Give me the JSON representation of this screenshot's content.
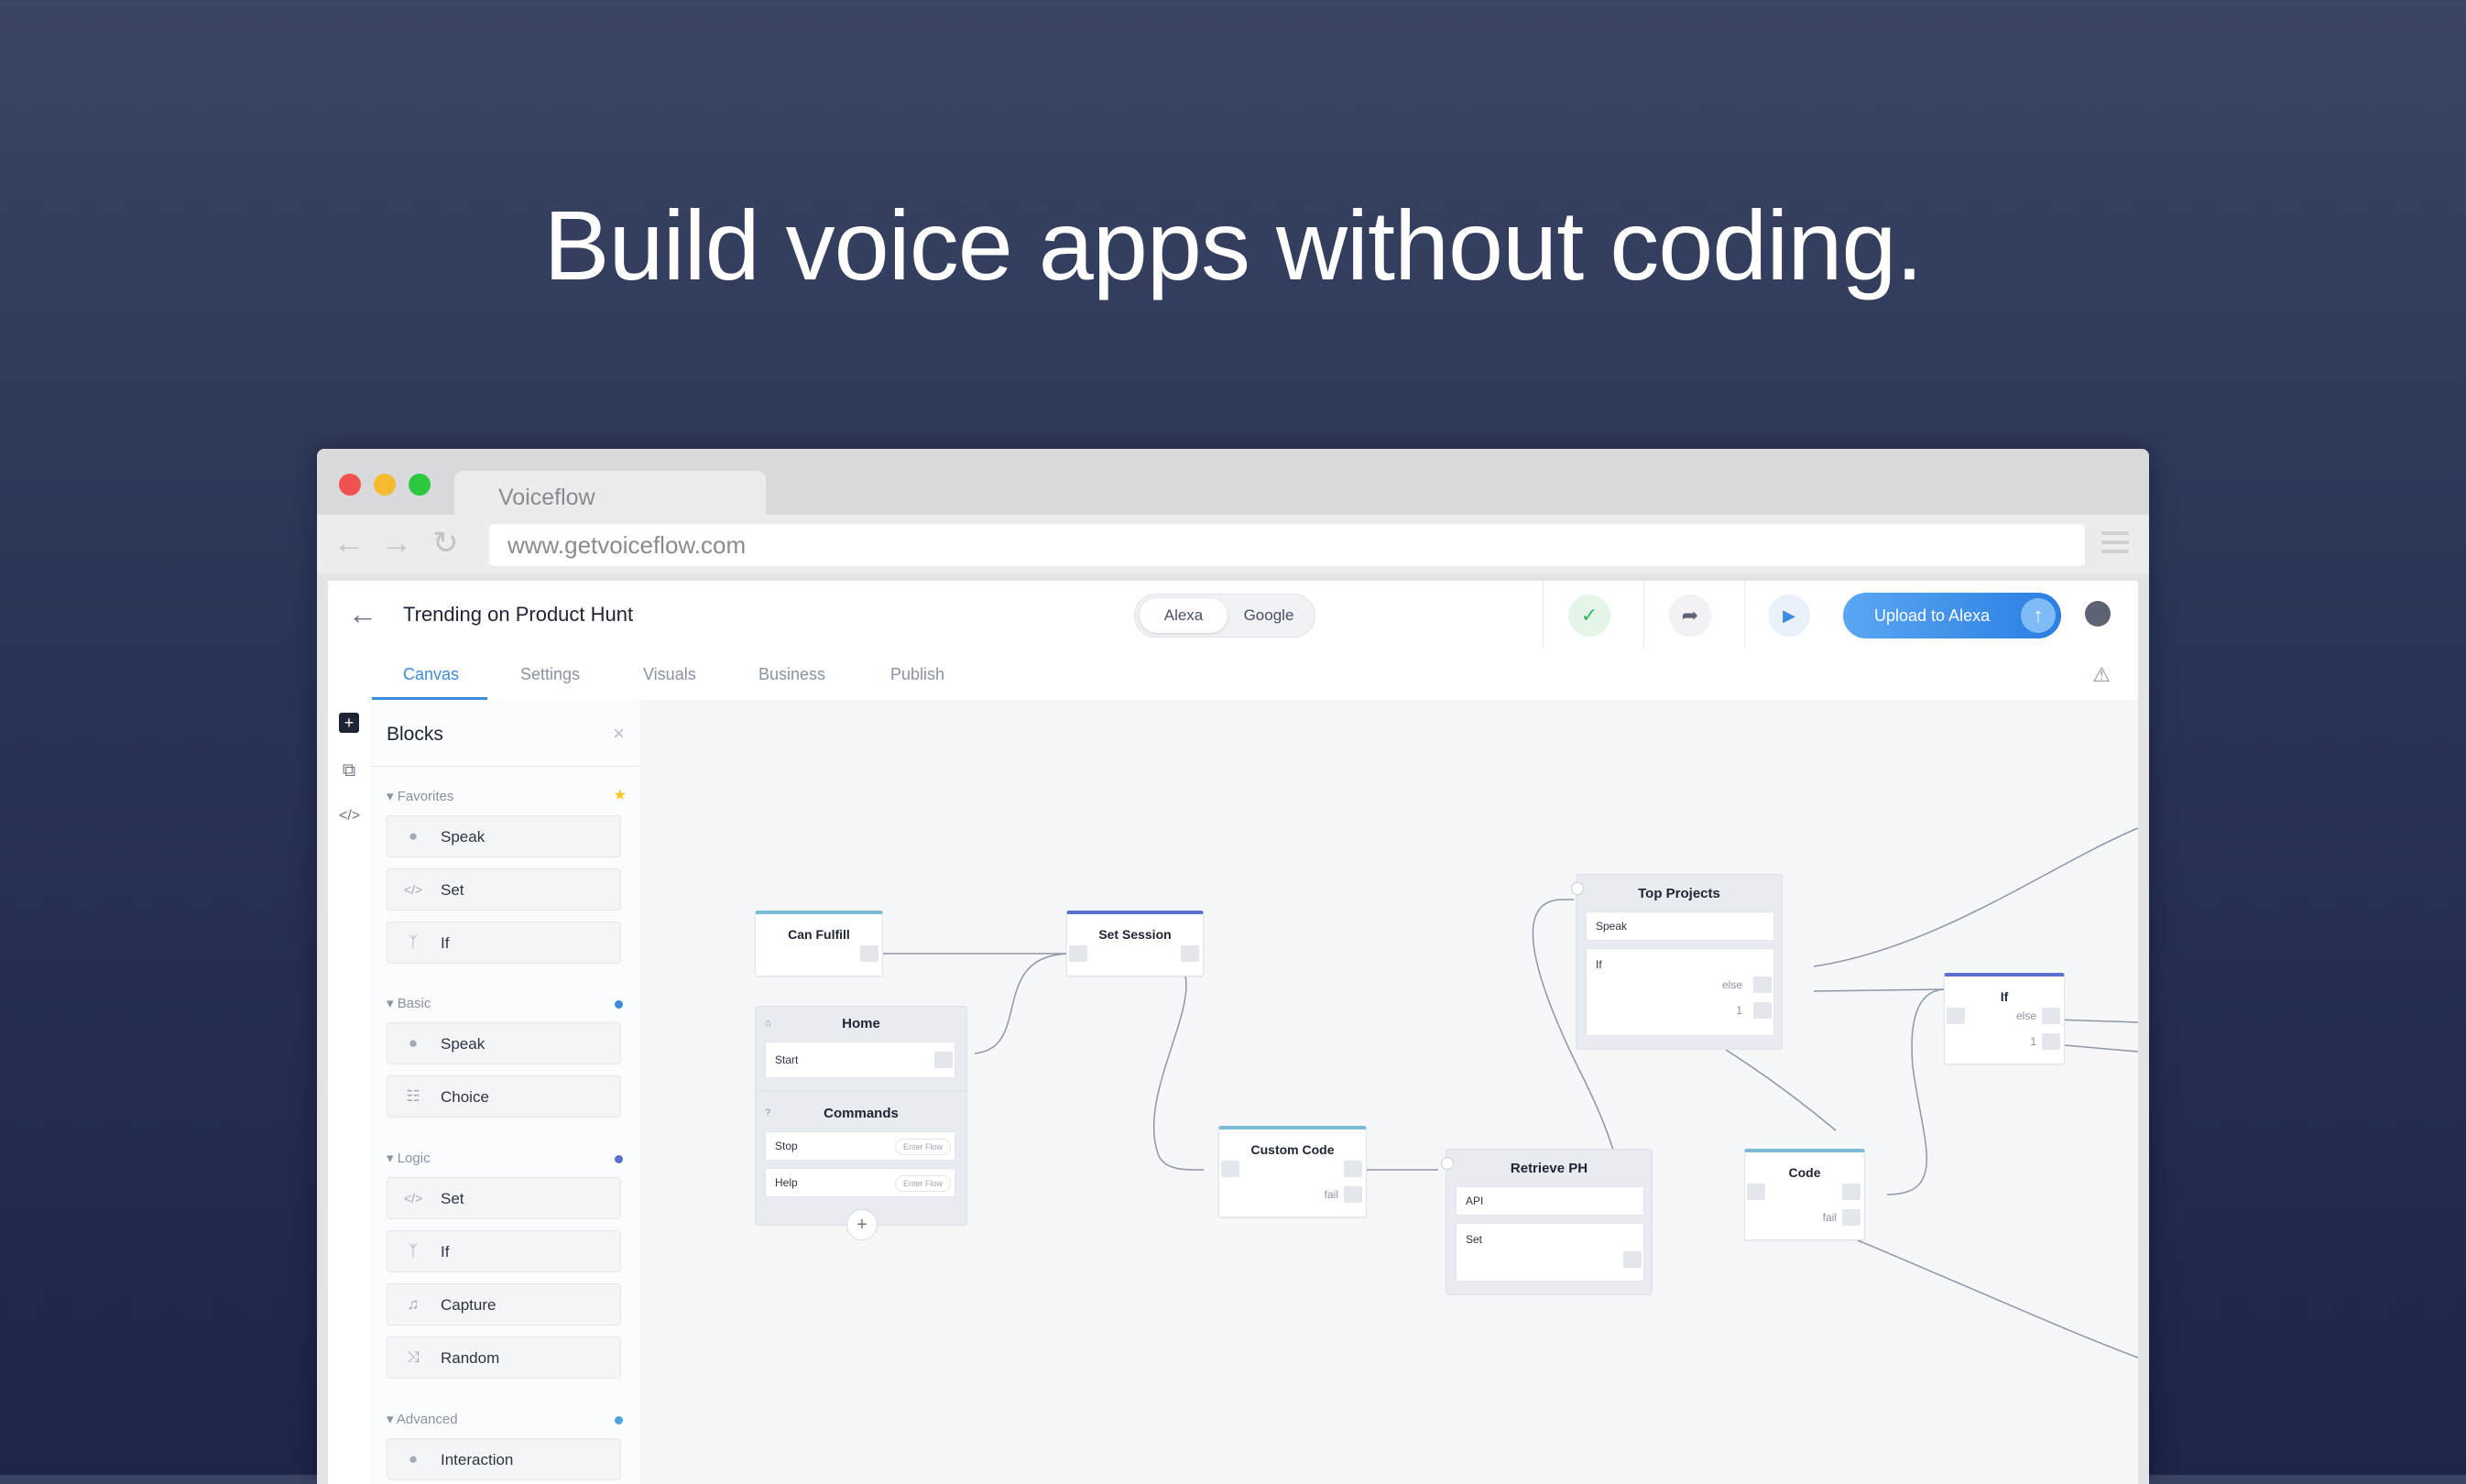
{
  "headline": "Build voice apps without coding.",
  "browser": {
    "tab_title": "Voiceflow",
    "url": "www.getvoiceflow.com"
  },
  "topbar": {
    "project_title": "Trending on Product Hunt",
    "platforms": [
      "Alexa",
      "Google"
    ],
    "selected_platform": "Alexa",
    "upload_label": "Upload to Alexa"
  },
  "tabs": [
    "Canvas",
    "Settings",
    "Visuals",
    "Business",
    "Publish"
  ],
  "active_tab": "Canvas",
  "panel": {
    "title": "Blocks",
    "sections": {
      "favorites": {
        "label": "Favorites",
        "items": [
          "Speak",
          "Set",
          "If"
        ]
      },
      "basic": {
        "label": "Basic",
        "items": [
          "Speak",
          "Choice"
        ]
      },
      "logic": {
        "label": "Logic",
        "items": [
          "Set",
          "If",
          "Capture",
          "Random"
        ]
      },
      "advanced": {
        "label": "Advanced",
        "items": [
          "Interaction"
        ]
      }
    }
  },
  "colors": {
    "accent": "#3d8bdb",
    "favorites_star": "#f5c518",
    "basic_dot": "#3d8bdb",
    "logic_dot": "#5b6fcf",
    "advanced_dot": "#4aa3df"
  },
  "canvas": {
    "can_fulfill": "Can Fulfill",
    "set_session": "Set Session",
    "home": {
      "title": "Home",
      "start": "Start"
    },
    "commands": {
      "title": "Commands",
      "stop": "Stop",
      "help": "Help",
      "enter_flow": "Enter Flow"
    },
    "custom_code": {
      "title": "Custom Code",
      "fail": "fail"
    },
    "retrieve_ph": {
      "title": "Retrieve PH",
      "api": "API",
      "set": "Set"
    },
    "top_projects": {
      "title": "Top Projects",
      "speak": "Speak",
      "if": "If",
      "else": "else",
      "one": "1"
    },
    "code": {
      "title": "Code",
      "fail": "fail"
    },
    "if_node": {
      "title": "If",
      "else": "else",
      "one": "1"
    }
  }
}
